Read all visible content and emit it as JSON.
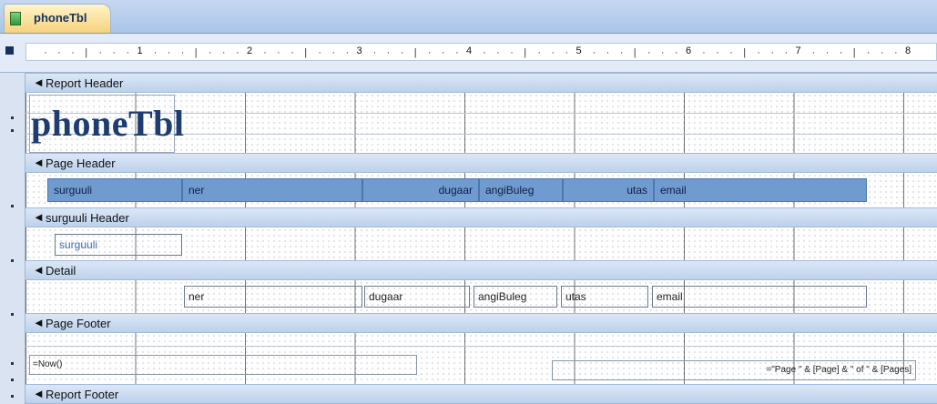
{
  "document_tab": {
    "label": "phoneTbl",
    "icon": "report-icon"
  },
  "ruler": {
    "numbers": [
      "1",
      "2",
      "3",
      "4",
      "5",
      "6",
      "7",
      "8"
    ]
  },
  "sections": {
    "report_header": "Report Header",
    "page_header": "Page Header",
    "group_header": "surguuli Header",
    "detail": "Detail",
    "page_footer": "Page Footer",
    "report_footer": "Report Footer"
  },
  "report_title": "phoneTbl",
  "page_header_labels": {
    "surguuli": "surguuli",
    "ner": "ner",
    "dugaar": "dugaar",
    "angiBuleg": "angiBuleg",
    "utas": "utas",
    "email": "email"
  },
  "group_field": "surguuli",
  "detail_fields": {
    "ner": "ner",
    "dugaar": "dugaar",
    "angiBuleg": "angiBuleg",
    "utas": "utas",
    "email": "email"
  },
  "footer": {
    "now_expr": "=Now()",
    "page_expr": "=\"Page \" & [Page] & \" of \" & [Pages]"
  },
  "colors": {
    "accent": "#6f9bd0",
    "band": "#bdd1ec",
    "title": "#1d3c70"
  }
}
